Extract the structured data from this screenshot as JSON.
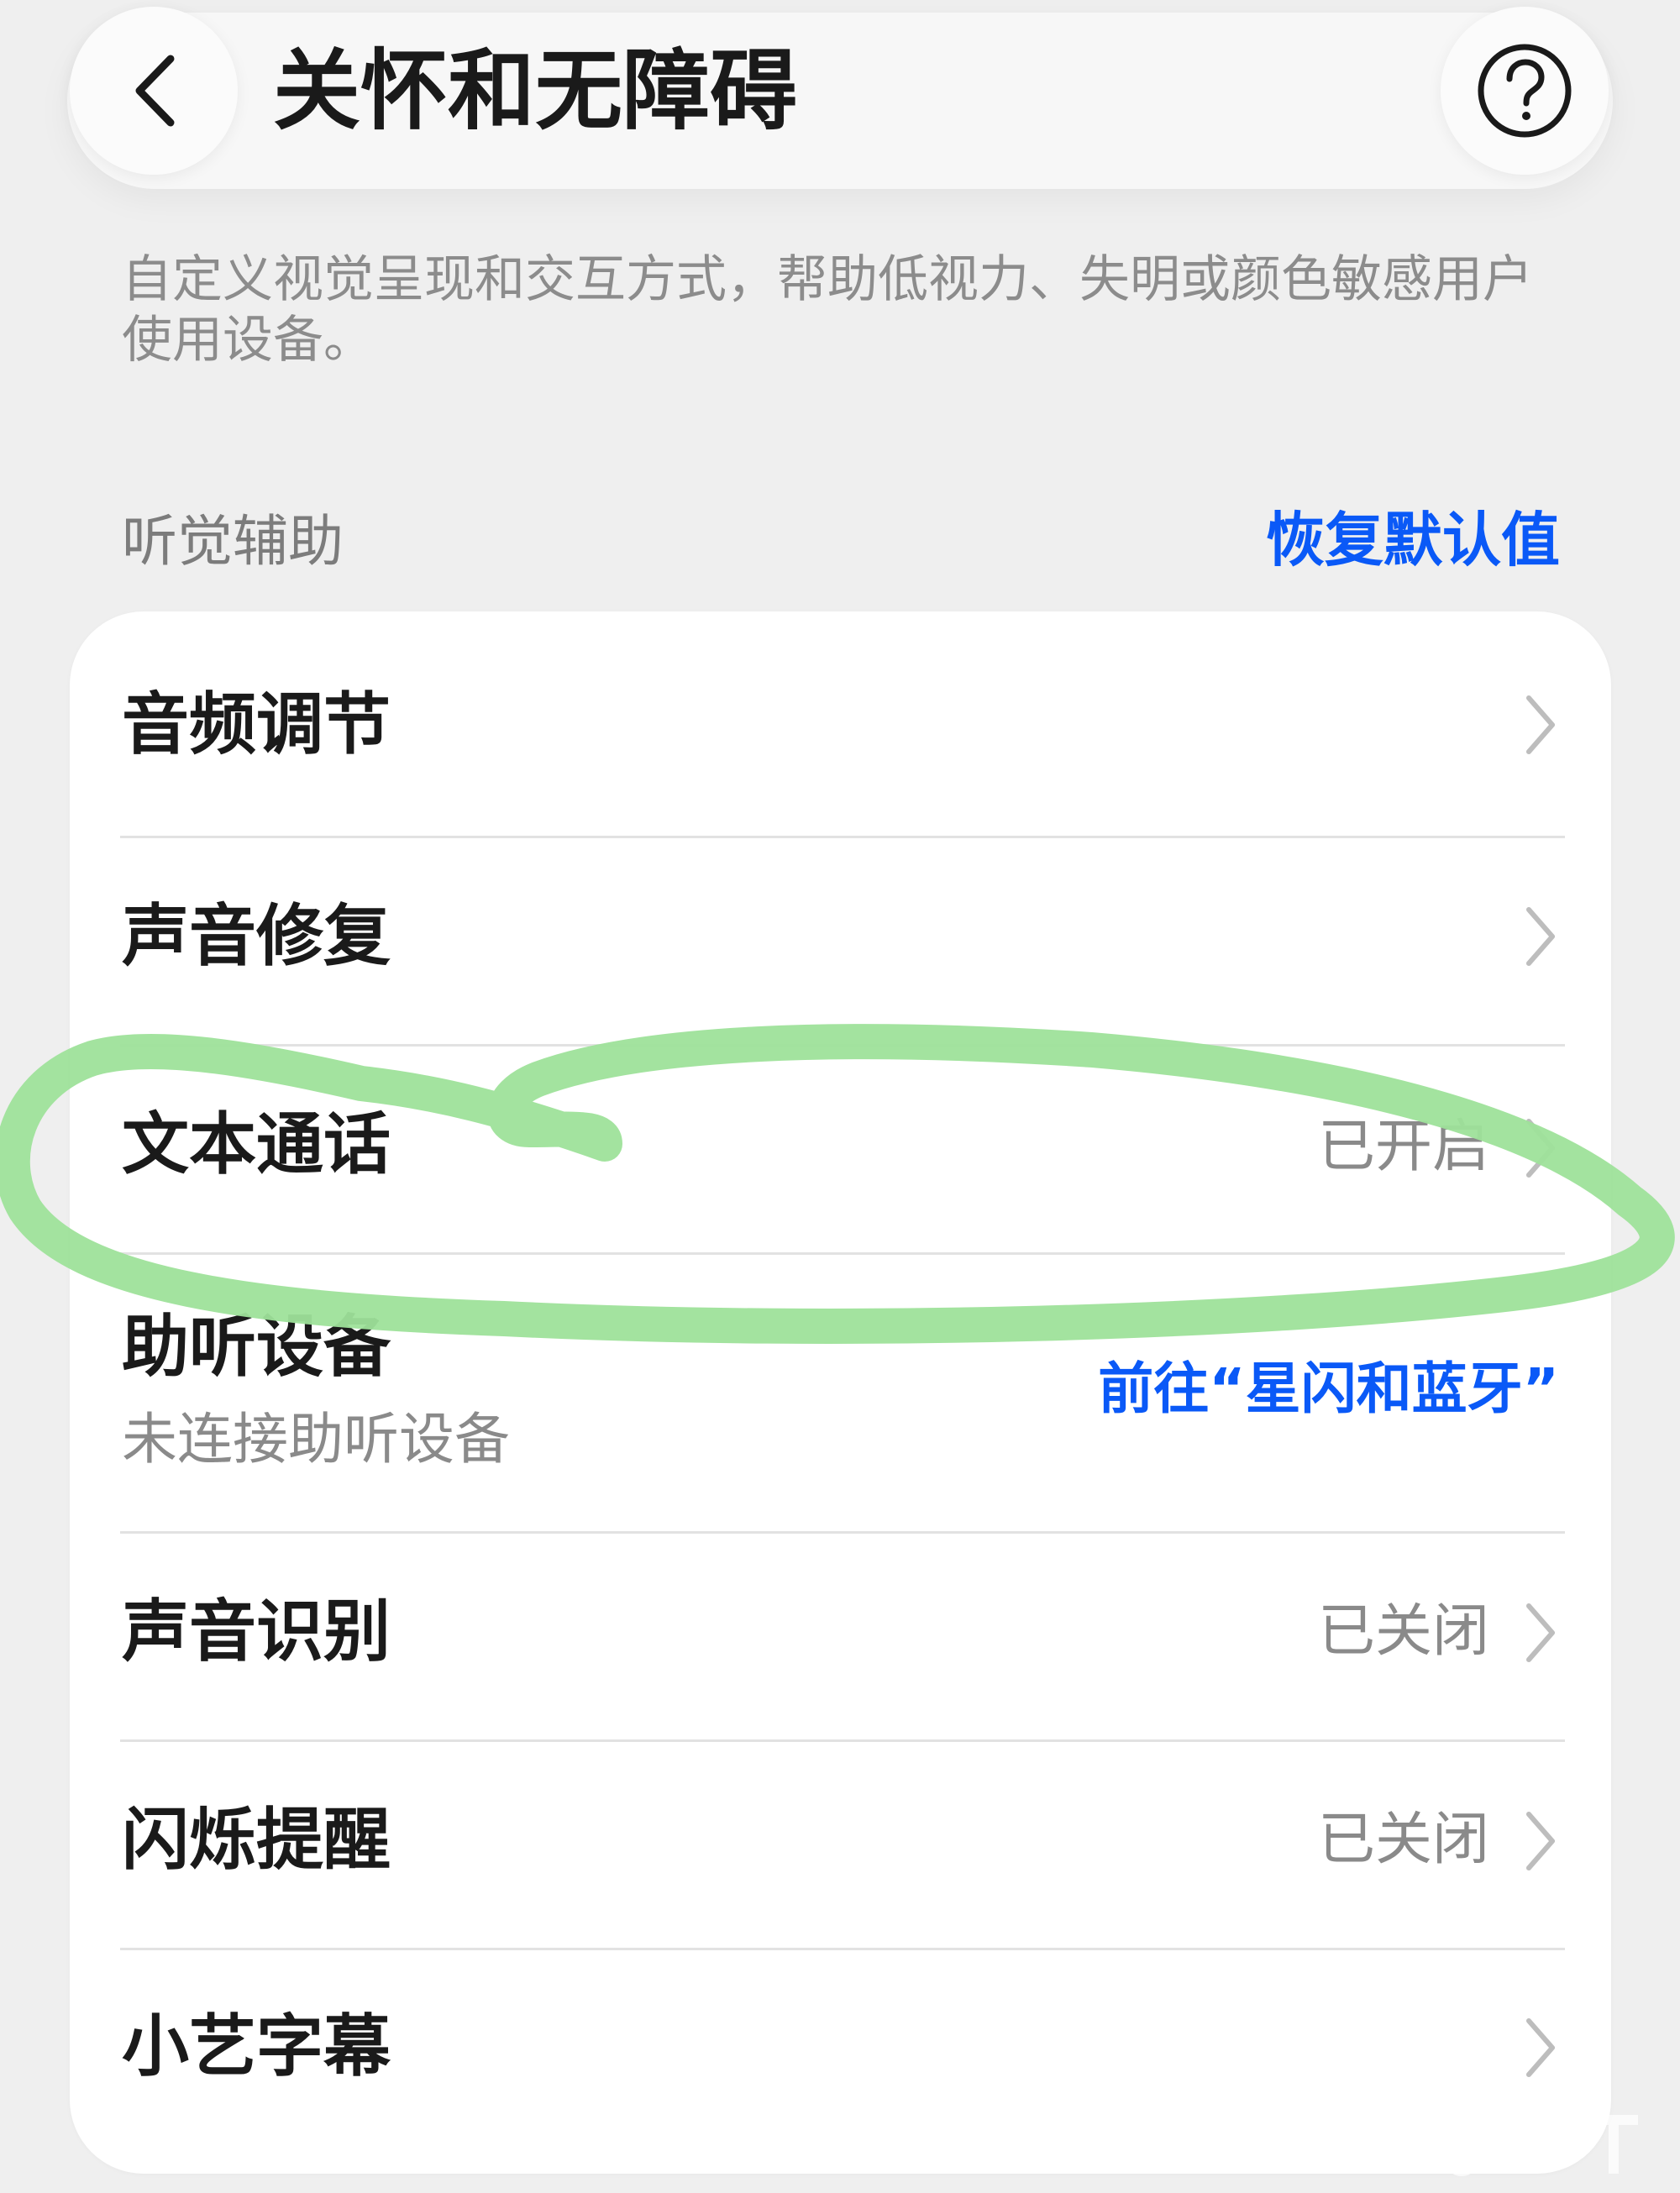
{
  "header": {
    "title": "关怀和无障碍",
    "back_icon": "chevron-left-icon",
    "help_icon": "question-circle-icon"
  },
  "description": "自定义视觉呈现和交互方式，帮助低视力、失明或颜色敏感用户使用设备。",
  "section": {
    "title": "听觉辅助",
    "reset_label": "恢复默认值"
  },
  "items": [
    {
      "label": "音频调节",
      "status": ""
    },
    {
      "label": "声音修复",
      "status": ""
    },
    {
      "label": "文本通话",
      "status": "已开启"
    },
    {
      "label": "助听设备",
      "subtitle": "未连接助听设备",
      "link": "前往“星闪和蓝牙”"
    },
    {
      "label": "声音识别",
      "status": "已关闭"
    },
    {
      "label": "闪烁提醒",
      "status": "已关闭"
    },
    {
      "label": "小艺字幕",
      "status": ""
    }
  ],
  "colors": {
    "accent": "#0a59f7",
    "background": "#efefef",
    "card": "#ffffff",
    "annotation": "#9ee29a"
  }
}
